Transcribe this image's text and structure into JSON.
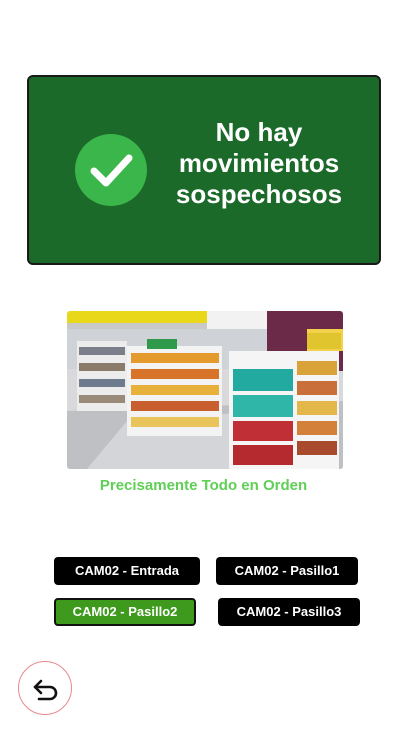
{
  "status": {
    "title": "No hay movimientos sospechosos",
    "icon": "checkmark-icon",
    "card_color": "#1b6a2a",
    "check_color": "#3bb64b"
  },
  "camera_view": {
    "image_description_icon": "store-aisle-photo",
    "caption": "Precisamente Todo en Orden",
    "caption_color": "#5fcf55"
  },
  "cameras": [
    {
      "label": "CAM02 - Entrada",
      "active": false
    },
    {
      "label": "CAM02 - Pasillo1",
      "active": false
    },
    {
      "label": "CAM02 - Pasillo2",
      "active": true
    },
    {
      "label": "CAM02 - Pasillo3",
      "active": false
    }
  ],
  "active_color": "#3e9a1d",
  "back": {
    "icon": "back-arrow-icon"
  }
}
